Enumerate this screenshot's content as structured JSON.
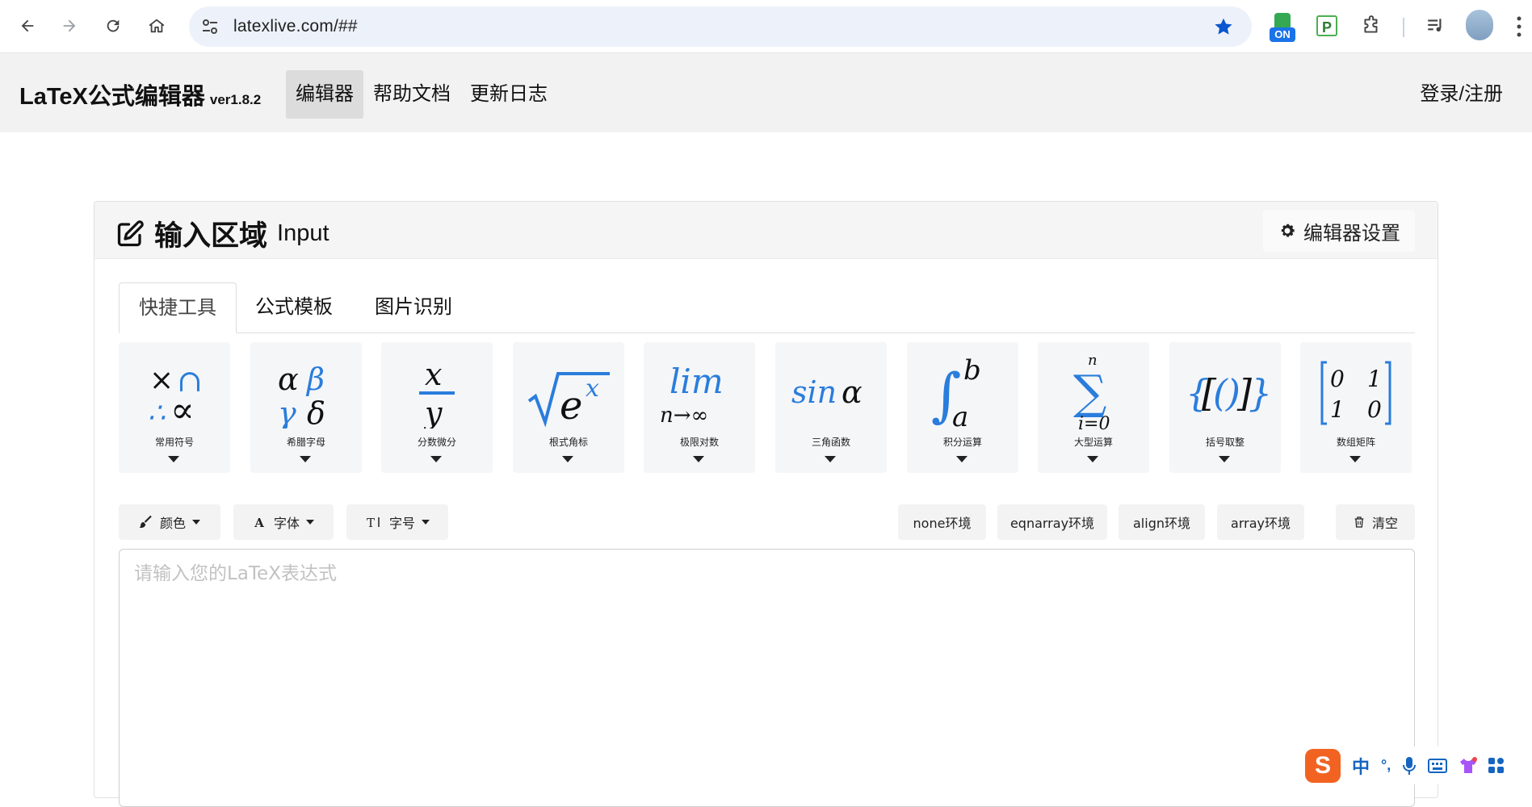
{
  "browser": {
    "url": "latexlive.com/##",
    "extension_badge": "ON",
    "extension_p": "P",
    "colors": {
      "accent": "#0b57d0",
      "omnibox_bg": "#edf2fa"
    }
  },
  "header": {
    "brand": "LaTeX公式编辑器",
    "version": "ver1.8.2",
    "nav": [
      "编辑器",
      "帮助文档",
      "更新日志"
    ],
    "login": "登录/注册"
  },
  "card": {
    "title": "输入区域",
    "title_en": "Input",
    "settings_label": "编辑器设置"
  },
  "tabs": [
    "快捷工具",
    "公式模板",
    "图片识别"
  ],
  "tools": [
    {
      "label": "常用符号",
      "icon": "symbols-icon"
    },
    {
      "label": "希腊字母",
      "icon": "greek-letters-icon"
    },
    {
      "label": "分数微分",
      "icon": "fraction-icon"
    },
    {
      "label": "根式角标",
      "icon": "radical-icon"
    },
    {
      "label": "极限对数",
      "icon": "limit-icon"
    },
    {
      "label": "三角函数",
      "icon": "trig-icon"
    },
    {
      "label": "积分运算",
      "icon": "integral-icon"
    },
    {
      "label": "大型运算",
      "icon": "summation-icon"
    },
    {
      "label": "括号取整",
      "icon": "brackets-icon"
    },
    {
      "label": "数组矩阵",
      "icon": "matrix-icon"
    }
  ],
  "toolbar": {
    "color": "颜色",
    "font": "字体",
    "size": "字号",
    "env_none": "none环境",
    "env_eqnarray": "eqnarray环境",
    "env_align": "align环境",
    "env_array": "array环境",
    "clear": "清空"
  },
  "editor": {
    "placeholder": "请输入您的LaTeX表达式",
    "value": ""
  },
  "ime": {
    "logo": "S",
    "lang": "中",
    "punct": "°,"
  }
}
